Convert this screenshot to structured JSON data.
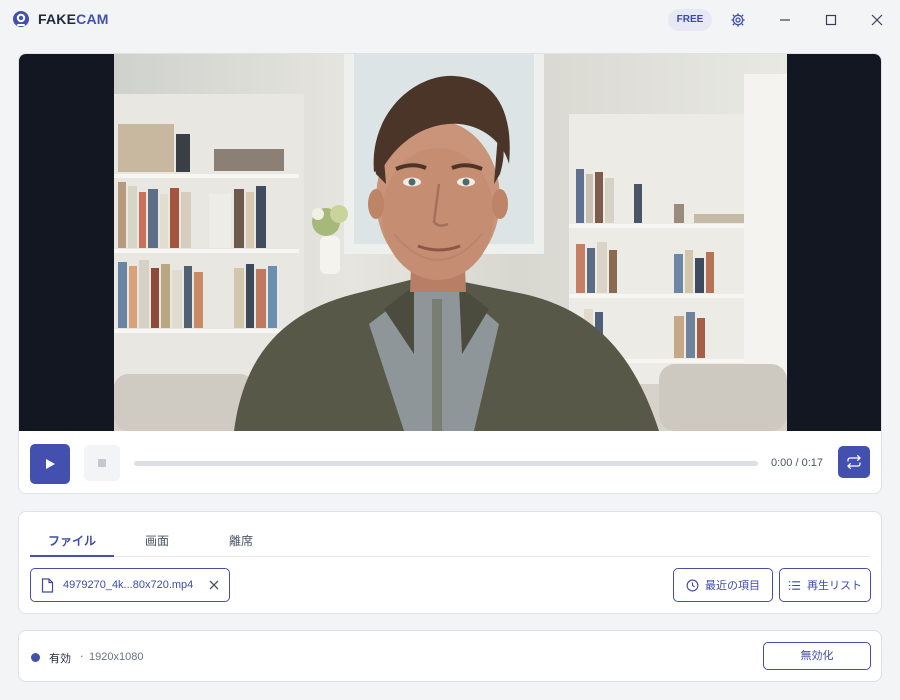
{
  "app": {
    "brand_part1": "FAKE",
    "brand_part2": "CAM",
    "plan_badge": "FREE",
    "logo_icon": "webcam-logo-icon",
    "window_icons": [
      "gear-icon",
      "minimize-icon",
      "maximize-icon",
      "close-icon"
    ]
  },
  "player": {
    "media_description": "webcam-video-frame",
    "play_icon": "play-icon",
    "stop_icon": "stop-icon",
    "loop_icon": "loop-icon",
    "progress": 0,
    "current_time": "0:00",
    "separator": "/",
    "duration": "0:17"
  },
  "tabs": [
    {
      "label": "ファイル",
      "active": true
    },
    {
      "label": "画面",
      "active": false
    },
    {
      "label": "離席",
      "active": false
    }
  ],
  "file": {
    "name": "4979270_4k...80x720.mp4",
    "icon": "file-icon",
    "remove_icon": "close-icon"
  },
  "buttons": {
    "recent": "最近の項目",
    "recent_icon": "clock-icon",
    "playlist": "再生リスト",
    "playlist_icon": "list-icon"
  },
  "status": {
    "label": "有効",
    "separator": "·",
    "resolution": "1920x1080",
    "disable_label": "無効化"
  },
  "colors": {
    "accent": "#4350b0",
    "background": "#f3f4f6",
    "video_letterbox": "#131722"
  }
}
